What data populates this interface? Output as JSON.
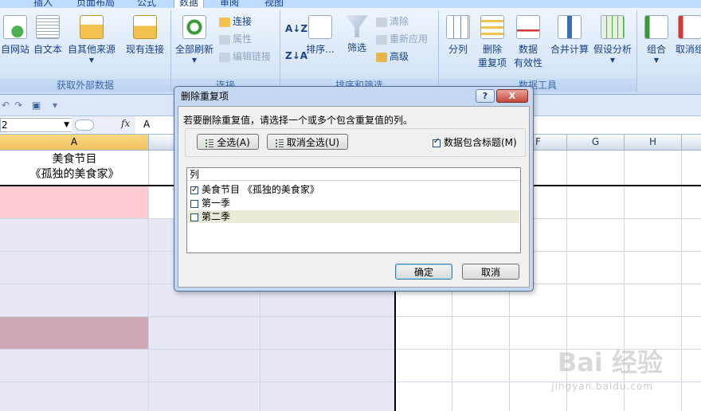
{
  "ribbon": {
    "tabs": [
      "插入",
      "页面布局",
      "公式",
      "数据",
      "审阅",
      "视图"
    ],
    "active_tab": "数据",
    "groups": {
      "external": {
        "label": "获取外部数据",
        "buttons": [
          "自网站",
          "自文本",
          "自其他来源",
          "现有连接"
        ]
      },
      "connections": {
        "label": "连接",
        "refresh": "全部刷新",
        "connect": "连接",
        "properties": "属性",
        "edit_links": "编辑链接"
      },
      "sort_filter": {
        "label": "排序和筛选",
        "sort": "排序...",
        "filter": "筛选",
        "clear": "清除",
        "reapply": "重新应用",
        "advanced": "高级"
      },
      "data_tools": {
        "label": "数据工具",
        "split": "分列",
        "remove_dup_1": "删除",
        "remove_dup_2": "重复项",
        "validation_1": "数据",
        "validation_2": "有效性",
        "consolidate": "合并计算",
        "whatif": "假设分析"
      },
      "outline": {
        "group": "组合",
        "ungroup": "取消组"
      }
    }
  },
  "formula_bar": {
    "name_box": "2",
    "fx_label": "fx",
    "value": "A"
  },
  "sheet": {
    "columns": [
      "A",
      "F",
      "G",
      "H"
    ],
    "cell_a1_line1": "美食节目",
    "cell_a1_line2": "《孤独的美食家》",
    "colors": {
      "pink_fill": "#ffccd6",
      "lavender_fill": "#e6e6f4",
      "mauve_fill": "#cfa9b6"
    }
  },
  "dialog": {
    "title": "删除重复项",
    "help": "?",
    "close": "X",
    "instruction": "若要删除重复值，请选择一个或多个包含重复值的列。",
    "select_all": "全选(A)",
    "unselect_all": "取消全选(U)",
    "header_checkbox_label": "数据包含标题(M)",
    "header_checkbox_checked": true,
    "list_header": "列",
    "columns": [
      {
        "label": "美食节目 《孤独的美食家》",
        "checked": true
      },
      {
        "label": "第一季",
        "checked": false
      },
      {
        "label": "第二季",
        "checked": false
      }
    ],
    "ok": "确定",
    "cancel": "取消"
  },
  "watermark": {
    "brand": "Bai 经验",
    "url": "jingyan.baidu.com"
  }
}
